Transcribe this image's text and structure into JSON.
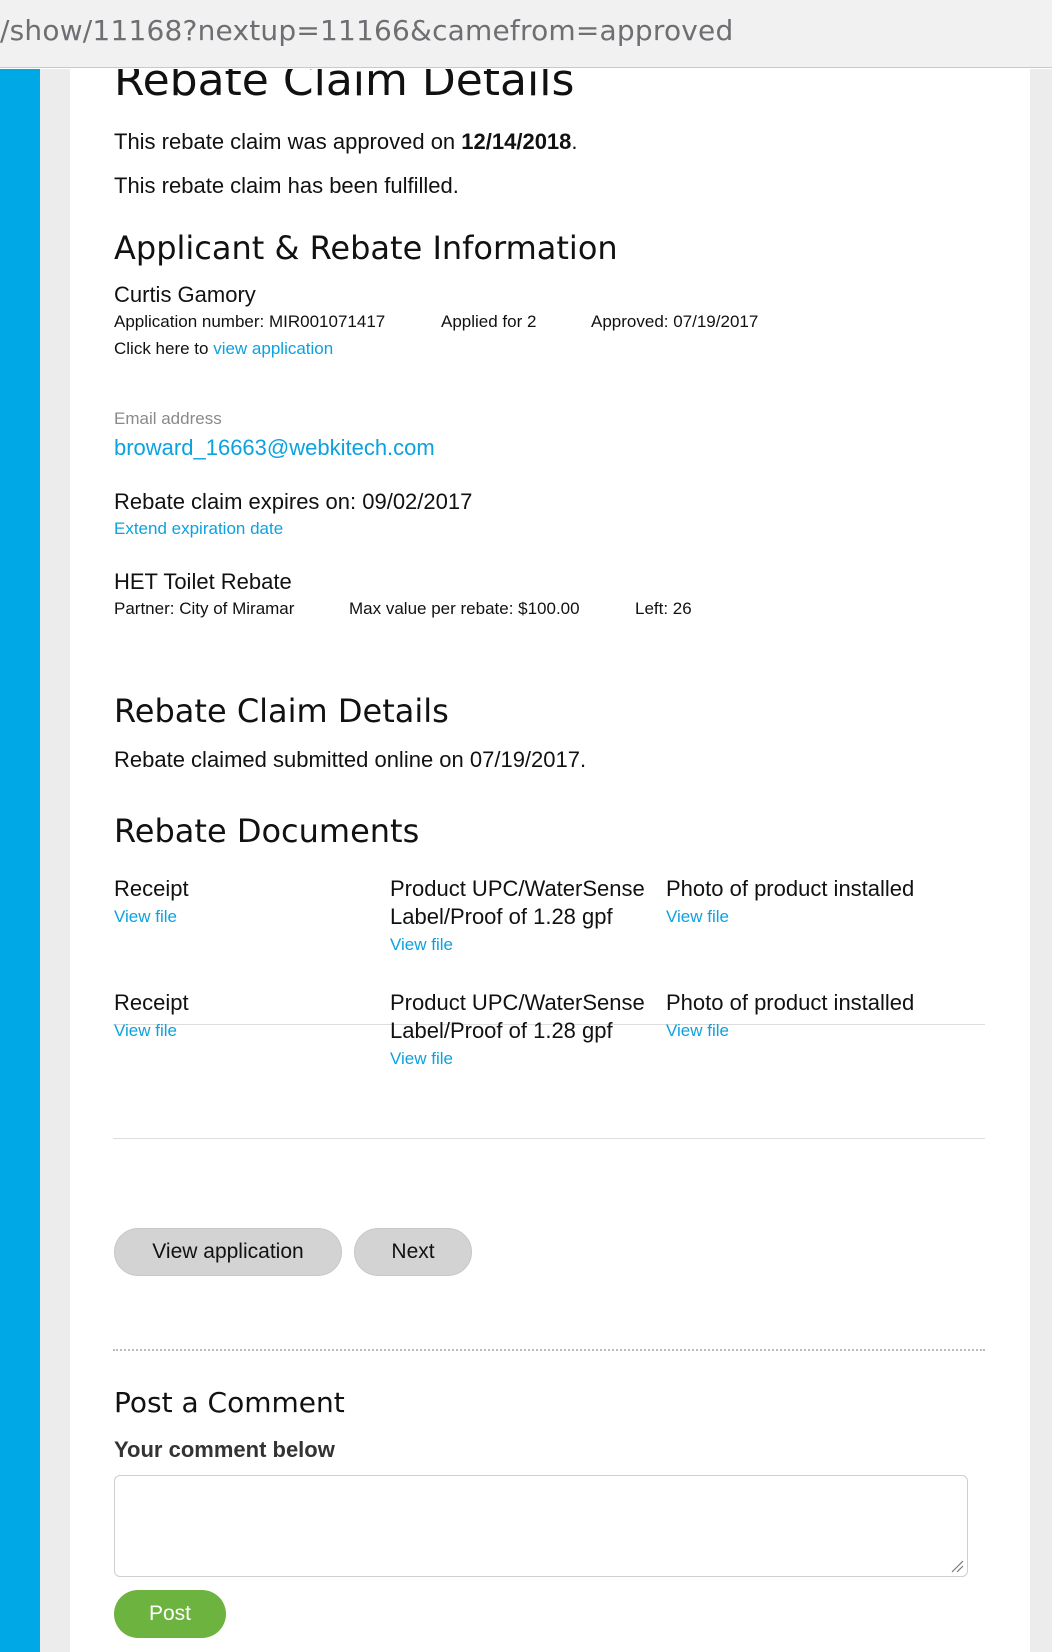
{
  "browser": {
    "url": "/show/11168?nextup=11166&camefrom=approved"
  },
  "page": {
    "title": "Rebate Claim Details",
    "approved_prefix": "This rebate claim was approved on ",
    "approved_date": "12/14/2018",
    "approved_suffix": ".",
    "fulfilled_text": "This rebate claim has been fulfilled."
  },
  "applicant": {
    "heading": "Applicant & Rebate Information",
    "name": "Curtis Gamory",
    "application_number": "Application number: MIR001071417",
    "applied_for": "Applied for 2",
    "approved": "Approved: 07/19/2017",
    "click_here": "Click here to ",
    "view_application_link": "view application",
    "email_label": "Email address",
    "email": "broward_16663@webkitech.com",
    "expires": "Rebate claim expires on: 09/02/2017",
    "extend_link": "Extend expiration date",
    "rebate_name": "HET Toilet Rebate",
    "partner": "Partner: City of Miramar",
    "max_value": "Max value per rebate: $100.00",
    "left": "Left: 26"
  },
  "claim": {
    "heading": "Rebate Claim Details",
    "submitted": "Rebate claimed submitted online on 07/19/2017."
  },
  "documents": {
    "heading": "Rebate Documents",
    "rows": [
      {
        "receipt_label": "Receipt",
        "receipt_link": "View file",
        "upc_label_line1": "Product UPC/WaterSense",
        "upc_label_line2": "Label/Proof of 1.28 gpf",
        "upc_link": "View file",
        "photo_label": "Photo of product installed",
        "photo_link": "View file"
      },
      {
        "receipt_label": "Receipt",
        "receipt_link": "View file",
        "upc_label_line1": "Product UPC/WaterSense",
        "upc_label_line2": "Label/Proof of 1.28 gpf",
        "upc_link": "View file",
        "photo_label": "Photo of product installed",
        "photo_link": "View file"
      }
    ]
  },
  "actions": {
    "view_application": "View application",
    "next": "Next"
  },
  "comment": {
    "heading": "Post a Comment",
    "label": "Your comment below",
    "value": "",
    "post": "Post"
  },
  "colors": {
    "accent": "#0ba2df",
    "sidebar": "#00a8e6",
    "post_button": "#6cb33f"
  }
}
